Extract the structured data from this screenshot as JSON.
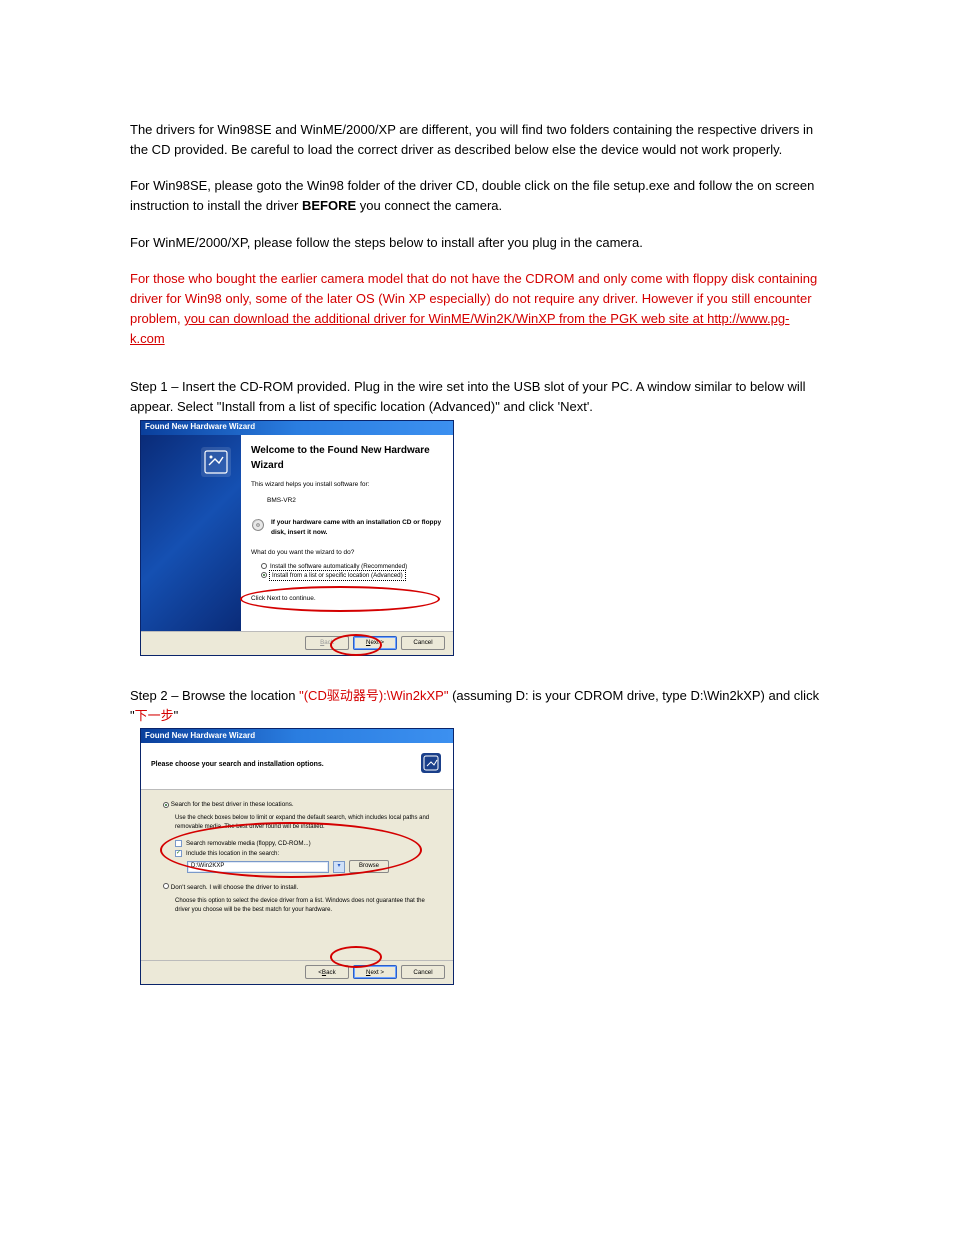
{
  "doc": {
    "p1": "The drivers for Win98SE and WinME/2000/XP are different, you will find two folders containing the respective drivers in the CD provided. Be careful to load the correct driver as described below else the device would not work properly.",
    "p2a": "For Win98SE, please goto the Win98 folder of the driver CD, double click on the file setup.exe and follow the on screen instruction to install the driver ",
    "p2b": "BEFORE",
    "p2c": " you connect the camera.",
    "p3": "For WinME/2000/XP, please follow the steps below to install after you plug in the camera.",
    "p4": "For those who bought the earlier camera model that do not have the CDROM and only come with floppy disk containing driver for Win98 only, some of the later OS (Win XP especially) do not require any driver. However if you still encounter problem, ",
    "p4link": "you can download the additional driver for WinME/Win2K/WinXP from the PGK web site at http://www.pg-k.com",
    "step1a": "Step 1 – Insert the CD-ROM provided. Plug in the wire set into the USB slot of your PC. A window similar to below will appear. Select \"",
    "step1b": "Install from a list of specific location (Advanced)",
    "step1c": "\" and click 'Next'.",
    "step2a": "Step 2 – Browse the location ",
    "step2b": "\"(CD驱动器号):\\Win2kXP\"",
    "step2c": " (assuming D: is your CDROM drive, type D:\\Win2kXP) and click \"",
    "step2d": "下一步",
    "step2e": "\""
  },
  "wizard1": {
    "title": "Found New Hardware Wizard",
    "heading": "Welcome to the Found New Hardware Wizard",
    "sub": "This wizard helps you install software for:",
    "device": "BMS-VR2",
    "cd_text": "If your hardware came with an installation CD or floppy disk, insert it now.",
    "question": "What do you want the wizard to do?",
    "opt1": "Install the software automatically (Recommended)",
    "opt2": "Install from a list or specific location (Advanced)",
    "cont": "Click Next to continue.",
    "back": "< Back",
    "next": "Next >",
    "cancel": "Cancel"
  },
  "wizard2": {
    "title": "Found New Hardware Wizard",
    "header": "Please choose your search and installation options.",
    "opt_best": "Search for the best driver in these locations.",
    "desc1": "Use the check boxes below to limit or expand the default search, which includes local paths and removable media. The best driver found will be installed.",
    "chk_removable": "Search removable media (floppy, CD-ROM...)",
    "chk_include": "Include this location in the search:",
    "path": "D:\\Win2KXP",
    "browse": "Browse",
    "opt_dont": "Don't search. I will choose the driver to install.",
    "desc2": "Choose this option to select the device driver from a list. Windows does not guarantee that the driver you choose will be the best match for your hardware.",
    "back": "< Back",
    "next": "Next >",
    "cancel": "Cancel"
  }
}
